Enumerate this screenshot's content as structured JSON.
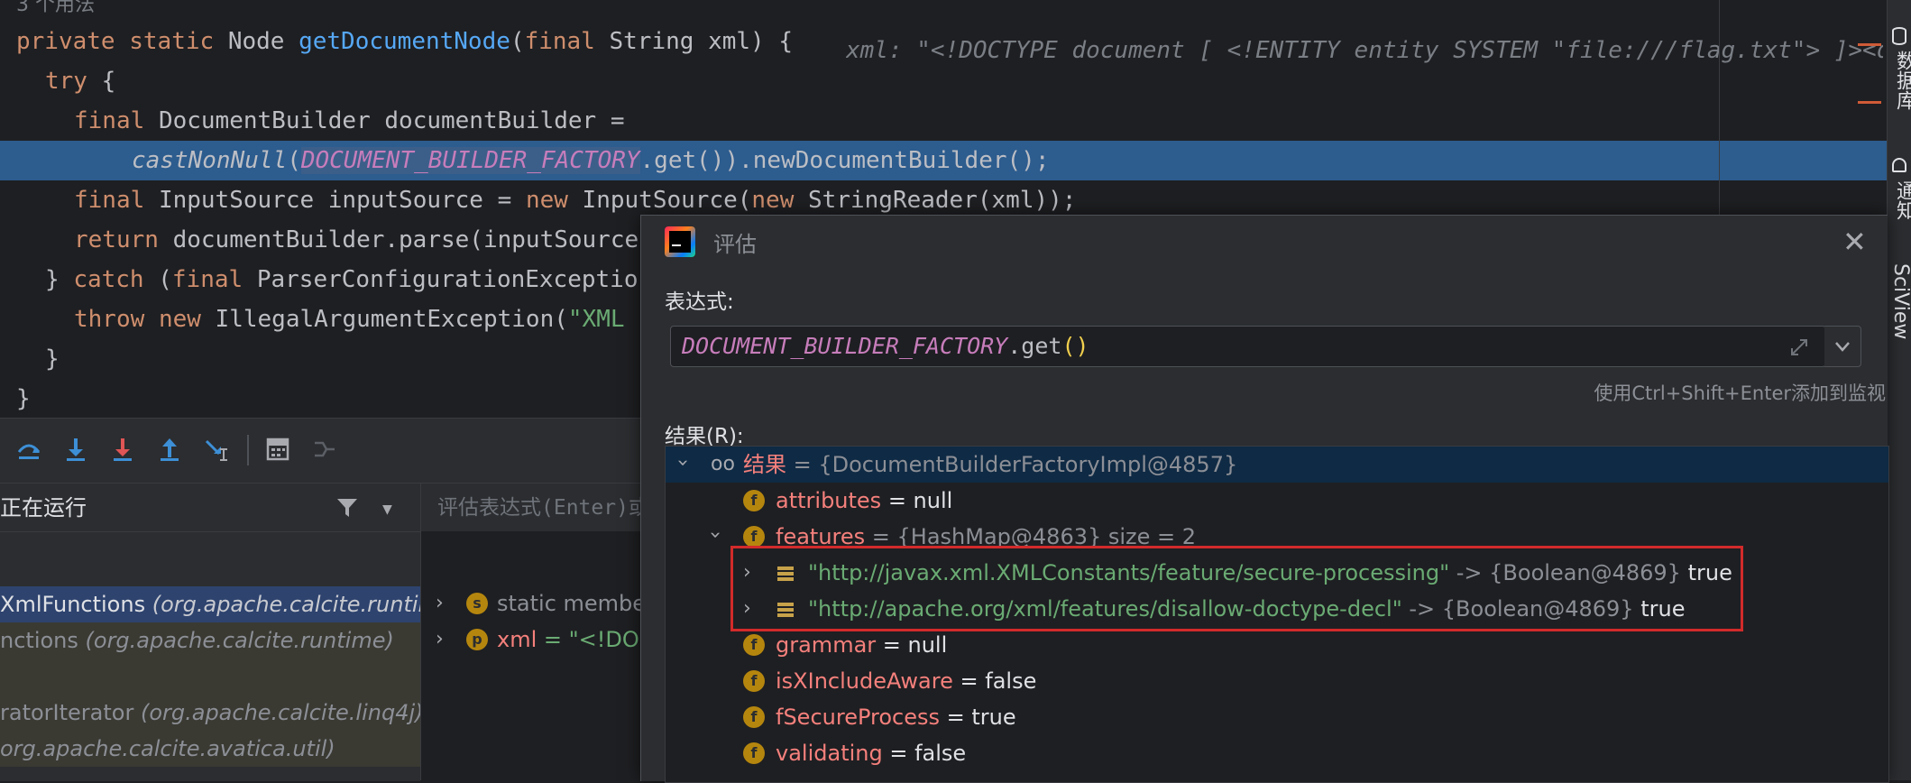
{
  "editor": {
    "usage_hint": "3 个用法",
    "lines": {
      "l1_kw1": "private",
      "l1_kw2": "static",
      "l1_type": "Node",
      "l1_fn": "getDocumentNode",
      "l1_param_kw": "final",
      "l1_param": "String xml) {",
      "l1_hint_label": "xml: ",
      "l1_hint_value": "\"<!DOCTYPE document [ <!ENTITY entity SYSTEM \"file:///flag.txt\"> ]><document>",
      "l2": "try {",
      "l3_kw": "final",
      "l3_rest": "DocumentBuilder documentBuilder =",
      "l4_fn": "castNonNull",
      "l4_const": "DOCUMENT_BUILDER_FACTORY",
      "l4_rest": ".get()).newDocumentBuilder();",
      "l5_kw": "final",
      "l5_a": "InputSource inputSource = ",
      "l5_new": "new",
      "l5_b": " InputSource(",
      "l5_new2": "new",
      "l5_c": " StringReader(xml));",
      "l6_kw": "return",
      "l6_rest": "documentBuilder.parse(inputSource",
      "l7_a": "} ",
      "l7_kw": "catch",
      "l7_b": " (",
      "l7_kw2": "final",
      "l7_c": " ParserConfigurationExceptio",
      "l8_kw": "throw",
      "l8_new": "new",
      "l8_a": " IllegalArgumentException(",
      "l8_str": "\"XML",
      "l9": "}",
      "l10": "}"
    }
  },
  "right_strip": {
    "label1": "数据库",
    "label2": "通知",
    "label3": "SciView"
  },
  "frames": {
    "header": "正在运行",
    "rows": [
      {
        "name": "XmlFunctions ",
        "pkg": "(org.apache.calcite.runtim"
      },
      {
        "name": "nctions ",
        "pkg": "(org.apache.calcite.runtime)"
      },
      {
        "name": "ratorIterator ",
        "pkg": "(org.apache.calcite.linq4j)"
      },
      {
        "name": "",
        "pkg": "org.apache.calcite.avatica.util)"
      }
    ]
  },
  "vars": {
    "placeholder": "评估表达式(Enter)或",
    "rows": [
      {
        "icon": "s",
        "name": "static member"
      },
      {
        "icon": "p",
        "name": "xml",
        "value": " = \"<!DOC"
      }
    ]
  },
  "dialog": {
    "title": "评估",
    "expr_label": "表达式:",
    "expr_const": "DOCUMENT_BUILDER_FACTORY",
    "expr_rest": ".get",
    "expr_paren": "()",
    "watch_hint": "使用Ctrl+Shift+Enter添加到监视",
    "result_label": "结果(R):",
    "tree": {
      "root_name": "结果",
      "root_value": " = {DocumentBuilderFactoryImpl@4857}",
      "attributes_name": "attributes",
      "attributes_value": " = null",
      "features_name": "features",
      "features_value": " = {HashMap@4863}  size = 2",
      "entry1_key": "\"http://javax.xml.XMLConstants/feature/secure-processing\"",
      "entry1_arrow": " -> {Boolean@4869} ",
      "entry1_val": "true",
      "entry2_key": "\"http://apache.org/xml/features/disallow-doctype-decl\"",
      "entry2_arrow": " -> {Boolean@4869} ",
      "entry2_val": "true",
      "grammar_name": "grammar",
      "grammar_value": " = null",
      "isx_name": "isXIncludeAware",
      "isx_value": " = false",
      "fsec_name": "fSecureProcess",
      "fsec_value": " = true",
      "valid_name": "validating",
      "valid_value": " = false"
    }
  }
}
